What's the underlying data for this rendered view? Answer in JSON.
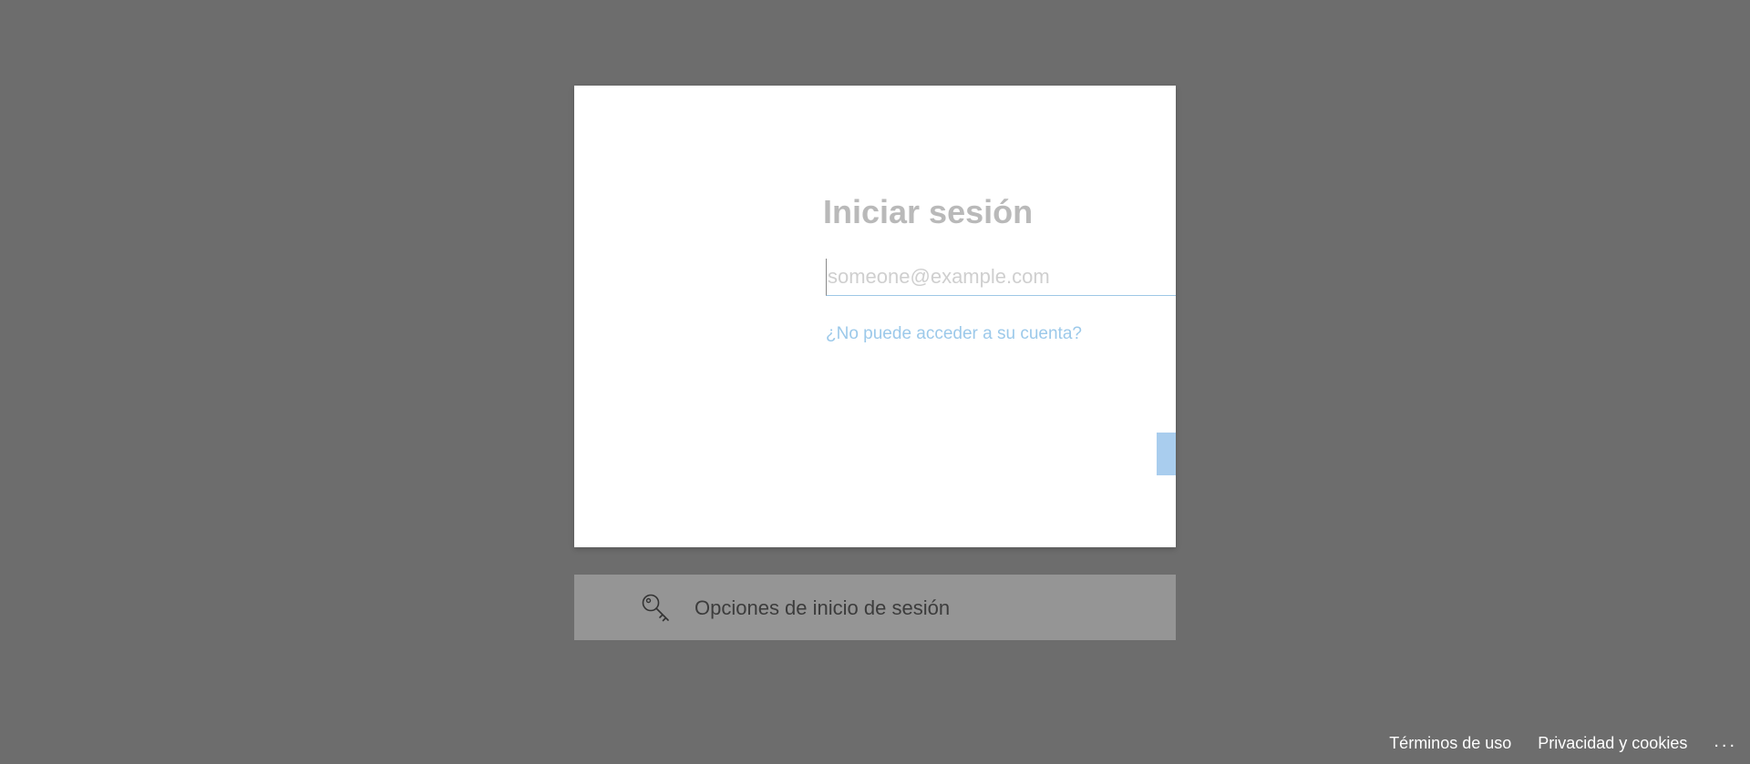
{
  "signin": {
    "title": "Iniciar sesión",
    "email_placeholder": "someone@example.com",
    "email_value": "",
    "cant_access_link": "¿No puede acceder a su cuenta?"
  },
  "options": {
    "icon": "key-icon",
    "label": "Opciones de inicio de sesión"
  },
  "footer": {
    "terms": "Términos de uso",
    "privacy": "Privacidad y cookies",
    "more": "..."
  },
  "colors": {
    "background": "#6d6d6d",
    "card": "#ffffff",
    "accent": "#a9cdee",
    "link": "#9cc9ea",
    "options_bar": "#959595"
  }
}
